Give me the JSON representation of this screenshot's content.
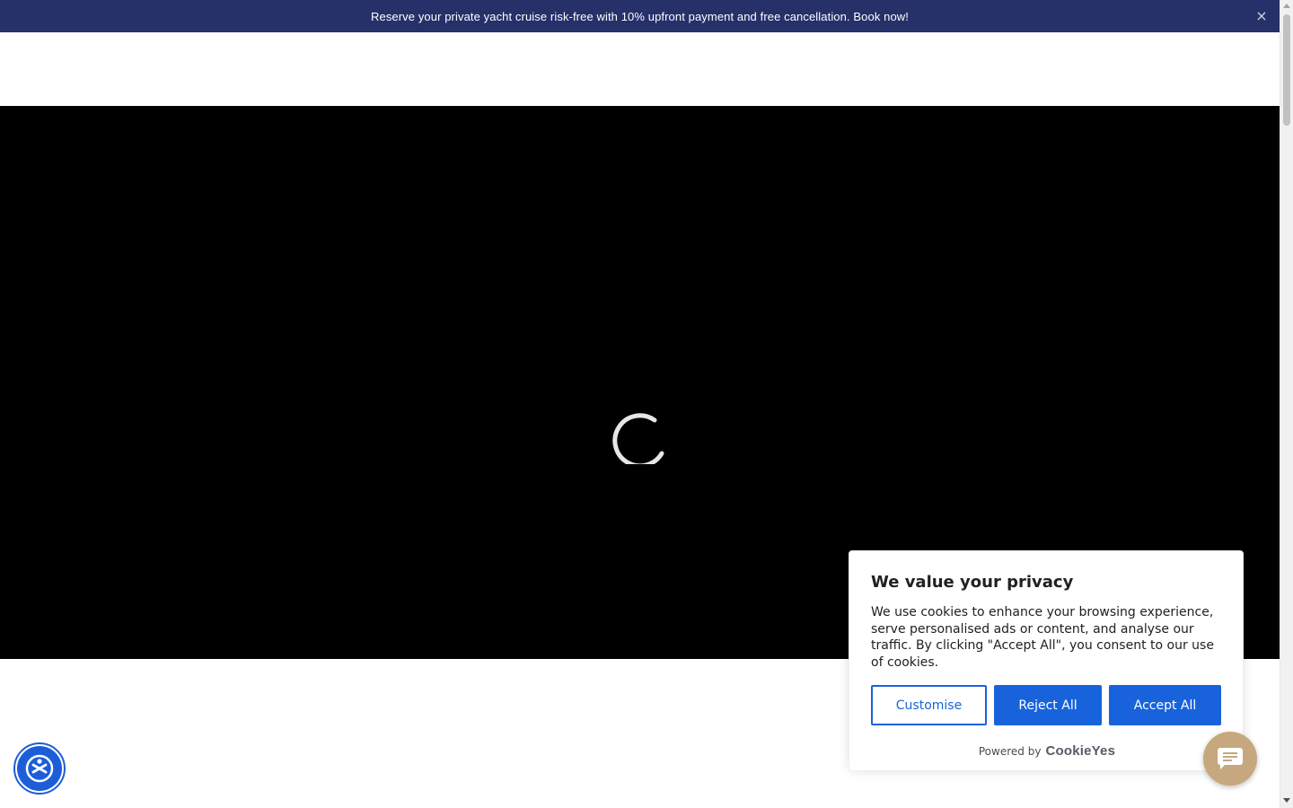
{
  "promo": {
    "text": "Reserve your private yacht cruise risk-free with 10% upfront payment and free cancellation. Book now!",
    "close_label": "×"
  },
  "hero": {
    "state": "loading",
    "spinner_icon": "loading-spinner-icon"
  },
  "cookie_banner": {
    "title": "We value your privacy",
    "description": "We use cookies to enhance your browsing experience, serve personalised ads or content, and analyse our traffic. By clicking \"Accept All\", you consent to our use of cookies.",
    "buttons": {
      "customise": "Customise",
      "reject": "Reject All",
      "accept": "Accept All"
    },
    "powered_by": "Powered by",
    "brand": "CookieYes"
  },
  "widgets": {
    "chat_icon": "chat-bubble-icon",
    "accessibility_icon": "accessibility-icon"
  },
  "colors": {
    "promo_bg": "#263069",
    "cookie_accent": "#1863dc",
    "chat_bg": "#c7a77d",
    "accessibility_blue": "#1d5ed8",
    "hero_bg": "#000000"
  }
}
